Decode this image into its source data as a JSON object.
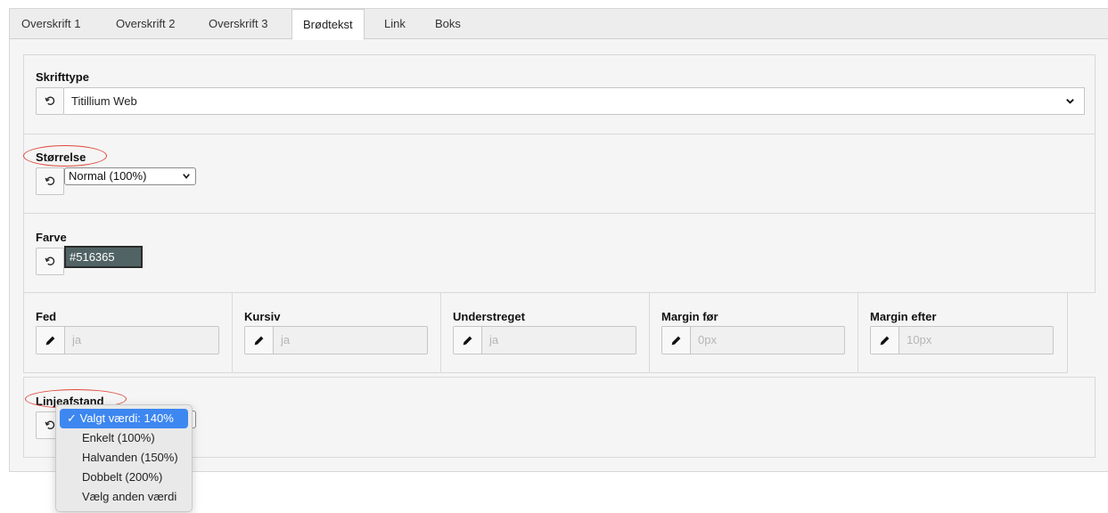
{
  "tabs": [
    {
      "label": "Overskrift 1"
    },
    {
      "label": "Overskrift 2"
    },
    {
      "label": "Overskrift 3"
    },
    {
      "label": "Brødtekst"
    },
    {
      "label": "Link"
    },
    {
      "label": "Boks"
    }
  ],
  "active_tab": "Brødtekst",
  "font": {
    "label": "Skrifttype",
    "value": "Titillium Web"
  },
  "size": {
    "label": "Størrelse",
    "value": "Normal (100%)"
  },
  "color": {
    "label": "Farve",
    "value": "#516365",
    "swatch": "#516365"
  },
  "styles": [
    {
      "label": "Fed",
      "placeholder": "ja"
    },
    {
      "label": "Kursiv",
      "placeholder": "ja"
    },
    {
      "label": "Understreget",
      "placeholder": "ja"
    },
    {
      "label": "Margin før",
      "placeholder": "0px"
    },
    {
      "label": "Margin efter",
      "placeholder": "10px"
    }
  ],
  "line_height": {
    "label": "Linjeafstand",
    "options": [
      {
        "label": "✓ Valgt værdi: 140%",
        "selected": true
      },
      {
        "label": "Enkelt (100%)"
      },
      {
        "label": "Halvanden (150%)"
      },
      {
        "label": "Dobbelt (200%)"
      },
      {
        "label": "Vælg anden værdi"
      }
    ]
  },
  "annotation_color": "#e0473b",
  "icons": {
    "reset": "reset-icon",
    "edit": "pencil-icon",
    "caret": "chevron-down-icon"
  }
}
